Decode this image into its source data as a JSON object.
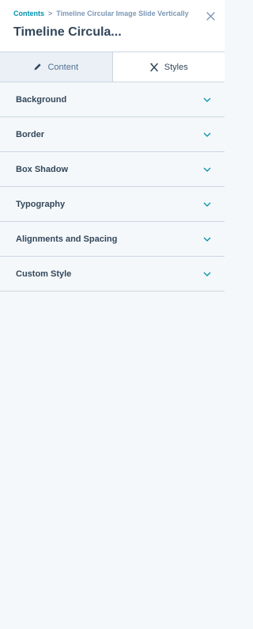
{
  "breadcrumb": {
    "root": "Contents",
    "separator": ">",
    "current": "Timeline Circular Image Slide Vertically"
  },
  "title": "Timeline Circula...",
  "tabs": [
    {
      "label": "Content",
      "icon": "pencil-icon",
      "active": false
    },
    {
      "label": "Styles",
      "icon": "brush-icon",
      "active": true
    }
  ],
  "sections": [
    {
      "label": "Background"
    },
    {
      "label": "Border"
    },
    {
      "label": "Box Shadow"
    },
    {
      "label": "Typography"
    },
    {
      "label": "Alignments and Spacing"
    },
    {
      "label": "Custom Style"
    }
  ],
  "colors": {
    "link": "#0091ae",
    "chevron": "#0091ae",
    "text": "#33475b",
    "muted": "#7c98b6",
    "border": "#cbd6e2",
    "section_bg": "#f5f8fa"
  }
}
